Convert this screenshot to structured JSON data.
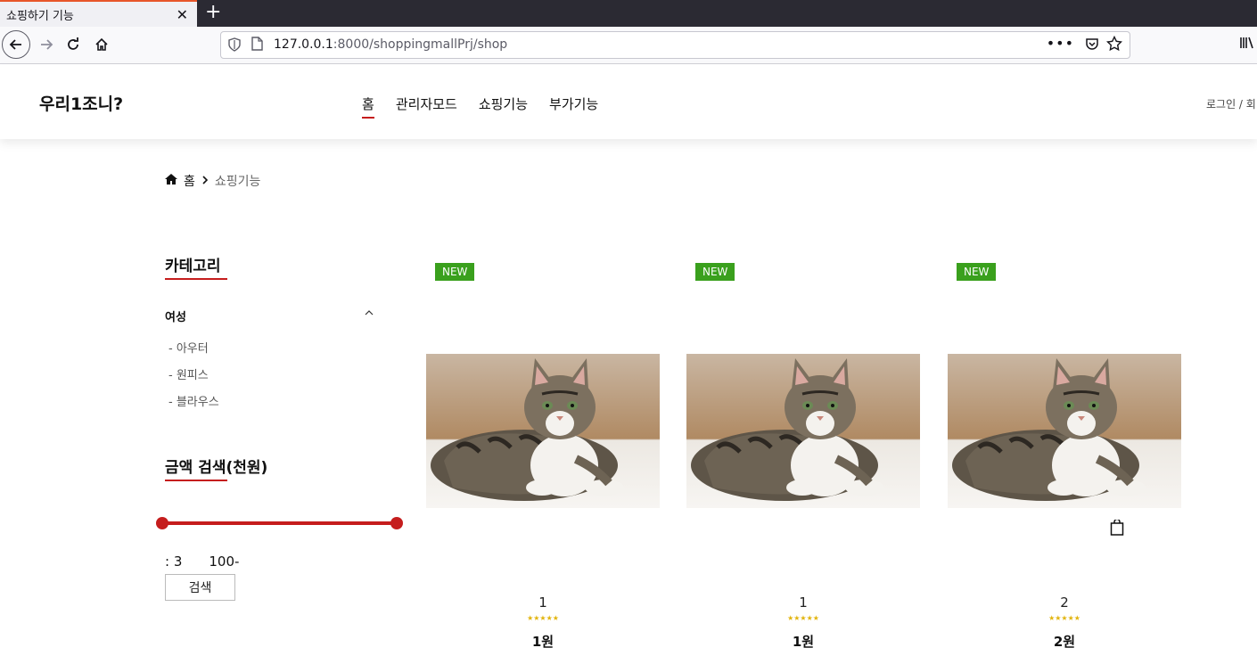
{
  "browser": {
    "tab_title": "쇼핑하기 기능",
    "tab_close": "✕",
    "new_tab": "+",
    "url_host": "127.0.0.1",
    "url_path": ":8000/shoppingmallPrj/shop",
    "more": "•••",
    "back_icon": "back-arrow-icon",
    "forward_icon": "forward-arrow-icon",
    "reload_icon": "reload-icon",
    "home_icon": "home-icon"
  },
  "header": {
    "logo": "우리1조니?",
    "nav": [
      {
        "label": "홈",
        "active": true
      },
      {
        "label": "관리자모드",
        "active": false
      },
      {
        "label": "쇼핑기능",
        "active": false
      },
      {
        "label": "부가기능",
        "active": false
      }
    ],
    "auth": "로그인 / 회"
  },
  "breadcrumb": {
    "home": "홈",
    "current": "쇼핑기능"
  },
  "sidebar": {
    "category_title": "카테고리",
    "group": "여성",
    "items": [
      "- 아우터",
      "- 원피스",
      "- 블라우스"
    ],
    "price_title": "금액 검색(천원)",
    "price_min": ": 3",
    "price_max": "100-",
    "search_label": "검색"
  },
  "products": [
    {
      "badge": "NEW",
      "name": "1",
      "stars": "★★★★★",
      "price": "1원",
      "show_cart": false
    },
    {
      "badge": "NEW",
      "name": "1",
      "stars": "★★★★★",
      "price": "1원",
      "show_cart": false
    },
    {
      "badge": "NEW",
      "name": "2",
      "stars": "★★★★★",
      "price": "2원",
      "show_cart": true
    }
  ],
  "colors": {
    "accent": "#c51d1d",
    "badge": "#3aa01d",
    "star": "#e2b40d"
  }
}
